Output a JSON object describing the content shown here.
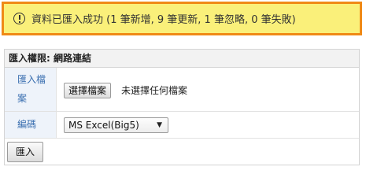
{
  "notice": {
    "icon": "info-icon",
    "message": "資料已匯入成功 (1 筆新增, 9 筆更新, 1 筆忽略, 0 筆失敗)",
    "background_color": "#faf07a",
    "border_color": "#f08a16"
  },
  "panel": {
    "title": "匯入權限: 網路連結",
    "file_row": {
      "label": "匯入檔案",
      "button_label": "選擇檔案",
      "status_text": "未選擇任何檔案"
    },
    "encoding_row": {
      "label": "編碼",
      "selected_value": "MS Excel(Big5)",
      "arrow": "▼"
    },
    "submit_label": "匯入"
  }
}
